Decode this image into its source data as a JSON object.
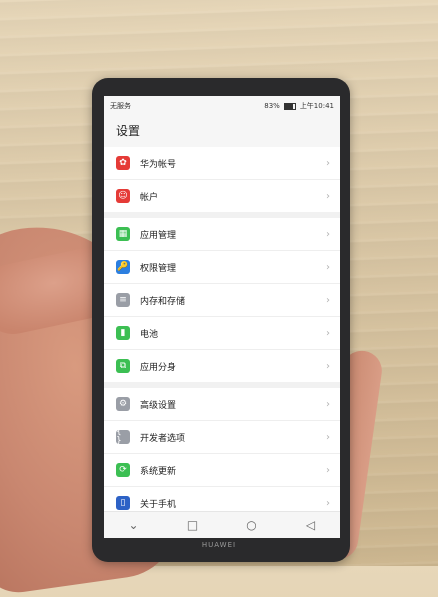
{
  "statusbar": {
    "left": "无服务",
    "battery": "83%",
    "time": "上午10:41"
  },
  "page": {
    "title": "设置"
  },
  "groups": [
    {
      "items": [
        {
          "label": "华为帐号",
          "icon": "huawei-account-icon",
          "color": "#e53b37"
        },
        {
          "label": "帐户",
          "icon": "account-icon",
          "color": "#e53b37"
        }
      ]
    },
    {
      "items": [
        {
          "label": "应用管理",
          "icon": "apps-icon",
          "color": "#3cbf53"
        },
        {
          "label": "权限管理",
          "icon": "key-icon",
          "color": "#2c7fe0"
        },
        {
          "label": "内存和存储",
          "icon": "storage-icon",
          "color": "#9a9ea6"
        },
        {
          "label": "电池",
          "icon": "battery-icon",
          "color": "#3cbf53"
        },
        {
          "label": "应用分身",
          "icon": "app-twin-icon",
          "color": "#3cbf53"
        }
      ]
    },
    {
      "items": [
        {
          "label": "高级设置",
          "icon": "gear-icon",
          "color": "#9a9ea6"
        },
        {
          "label": "开发者选项",
          "icon": "developer-icon",
          "color": "#9a9ea6"
        },
        {
          "label": "系统更新",
          "icon": "system-update-icon",
          "color": "#3cbf53"
        },
        {
          "label": "关于手机",
          "icon": "phone-info-icon",
          "color": "#2d62c6"
        }
      ]
    }
  ],
  "navbar": {
    "down": "⌄",
    "recent": "□",
    "home": "○",
    "back": "◁"
  },
  "phone_brand": "HUAWEI"
}
